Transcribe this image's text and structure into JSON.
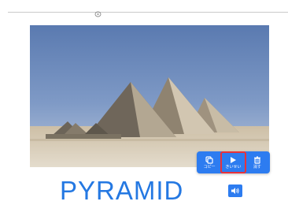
{
  "toolbar": {
    "copy_label": "コピー",
    "play_label": "きいせい",
    "delete_label": "消す",
    "copy_icon": "copy-icon",
    "play_icon": "play-icon",
    "delete_icon": "trash-icon",
    "accent_color": "#2d7cf0",
    "active_outline_color": "#e8323a"
  },
  "card": {
    "word": "PYRAMID",
    "word_color": "#2478e2",
    "image_alt": "pyramids-photo",
    "speaker_icon": "speaker-icon"
  }
}
